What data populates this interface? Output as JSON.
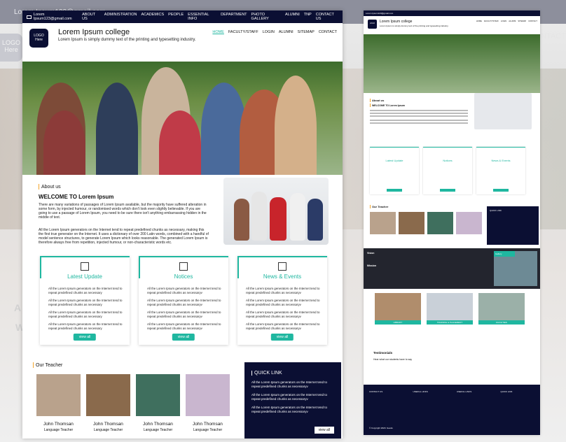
{
  "topbar": {
    "email": "Lorem Ipsum123@gmail.com",
    "nav": [
      "ABOUT US",
      "ADMINISTRATION",
      "ACADEMICS",
      "PEOPLE",
      "ESSENTIAL INFO",
      "DEPARTMENT",
      "PHOTO GALLERY",
      "ALUMNI",
      "TNP",
      "CONTACT US"
    ]
  },
  "header": {
    "logo_line1": "LOGO",
    "logo_line2": "Here",
    "college": "Lorem Ipsum college",
    "tagline": "Lorem Ipsum is simply dummy text of the printing and typesetting industry.",
    "nav": [
      "HOME",
      "FACULTY/STAFF",
      "LOGIN",
      "ALUMNI",
      "SITEMAP",
      "CONTACT"
    ]
  },
  "about": {
    "section": "About us",
    "heading": "WELCOME TO Lorem Ipsum",
    "para1": "There are many variations of passages of Lorem Ipsum available, but the majority have suffered alteration in some form, by injected humour, or randomised words which don't look even slightly believable. If you are going to use a passage of Lorem Ipsum, you need to be sure there isn't anything embarrassing hidden in the middle of text.",
    "para2": "All the Lorem Ipsum generators on the Internet tend to repeat predefined chunks as necessary, making this the first true generator on the Internet. It uses a dictionary of over 200 Latin words, combined with a handful of model sentence structures, to generate Lorem Ipsum which looks reasonable. The generated Lorem Ipsum is therefore always free from repetition, injected humour, or non-characteristic words etc."
  },
  "cards": [
    {
      "title": "Latest Update",
      "items": [
        "All the Lorem Ipsum generators on the Internet tend to repeat predefined chunks as necessary",
        "All the Lorem Ipsum generators on the Internet tend to repeat predefined chunks as necessary",
        "All the Lorem Ipsum generators on the Internet tend to repeat predefined chunks as necessary",
        "All the Lorem Ipsum generators on the Internet tend to repeat predefined chunks as necessary"
      ],
      "button": "view all"
    },
    {
      "title": "Notices",
      "items": [
        "All the Lorem Ipsum generators on the Internet tend to repeat predefined chunks as necessaryv",
        "All the Lorem Ipsum generators on the Internet tend to repeat predefined chunks as necessaryv",
        "All the Lorem Ipsum generators on the Internet tend to repeat predefined chunks as necessaryv",
        "All the Lorem Ipsum generators on the Internet tend to repeat predefined chunks as necessaryv"
      ],
      "button": "view all"
    },
    {
      "title": "News & Events",
      "items": [
        "All the Lorem Ipsum generators on the Internet tend to repeat predefined chunks as necessaryv",
        "All the Lorem Ipsum generators on the Internet tend to repeat predefined chunks as necessaryv",
        "All the Lorem Ipsum generators on the Internet tend to repeat predefined chunks as necessaryv",
        "All the Lorem Ipsum generators on the Internet tend to repeat predefined chunks as necessaryv"
      ],
      "button": "view all"
    }
  ],
  "teachers": {
    "section": "Our Teacher",
    "list": [
      {
        "name": "John Thomsan",
        "role": "Language Teacher"
      },
      {
        "name": "John Thomsan",
        "role": "Language Teacher"
      },
      {
        "name": "John Thomsan",
        "role": "Language Teacher"
      },
      {
        "name": "John Thomsan",
        "role": "Language Teacher"
      }
    ]
  },
  "quick": {
    "title": "QUICK LINK",
    "items": [
      "All the Lorem Ipsum generators on the Internet tend to repeat predefined chunks as necessaryv",
      "All the Lorem Ipsum generators on the Internet tend to repeat predefined chunks as necessaryv",
      "All the Lorem Ipsum generators on the Internet tend to repeat predefined chunks as necessaryv"
    ],
    "button": "view all"
  },
  "thumb": {
    "email": "Lorem Ipsum123@gmail.com",
    "college": "Lorem Ipsum college",
    "tagline": "Lorem Ipsum is simply dummy text of the printing and typesetting industry.",
    "nav": [
      "HOME",
      "FACULTY/STAFF",
      "LOGIN",
      "ALUMNI",
      "SITEMAP",
      "CONTACT"
    ],
    "about": "About us",
    "welcome": "WELCOME TO Lorem Ipsum",
    "cards": [
      "Latest Update",
      "Notices",
      "News & Events"
    ],
    "team": "Our Teacher",
    "quick": "QUICK LINK",
    "vision": "Vision",
    "mission": "Mission",
    "gallery": "Gallery",
    "facilities": [
      "LIBRARY",
      "TRAINING & PLACEMENT",
      "FACILITIES"
    ],
    "testimonials": "Testimonials",
    "testi_text": "Hear what our students have to say",
    "footer": [
      "CONTACT US",
      "USEFUL LINKS",
      "USEFUL LINKS",
      "QUICK LINK"
    ],
    "copyright": "© Copyright 2020. Geeks"
  },
  "colors": {
    "navy": "#0b0f33",
    "accent": "#1fb7a0",
    "section_marker": "#f3a52b"
  }
}
